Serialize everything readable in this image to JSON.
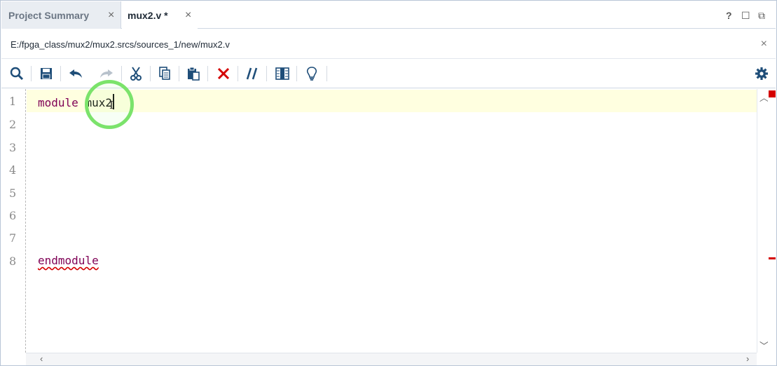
{
  "tabs": [
    {
      "label": "Project Summary",
      "active": false
    },
    {
      "label": "mux2.v *",
      "active": true
    }
  ],
  "tab_close_glyph": "×",
  "window_controls": {
    "help": "?",
    "restore": "☐",
    "float": "⧉"
  },
  "file_path": "E:/fpga_class/mux2/mux2.srcs/sources_1/new/mux2.v",
  "toolbar": {
    "icons": [
      "search-icon",
      "save-icon",
      "undo-icon",
      "redo-icon",
      "cut-icon",
      "copy-icon",
      "paste-icon",
      "delete-icon",
      "comment-icon",
      "column-select-icon",
      "lightbulb-icon",
      "gear-icon"
    ]
  },
  "editor": {
    "line_numbers": [
      "1",
      "2",
      "3",
      "4",
      "5",
      "6",
      "7",
      "8"
    ],
    "line1_keyword": "module",
    "line1_identifier": "mux2",
    "line8_keyword": "endmodule"
  },
  "colors": {
    "keyword": "#7f0055",
    "current_line": "#ffffe0",
    "error_marker": "#d40000",
    "delete_icon": "#d40000",
    "icon_blue": "#1f4e79"
  }
}
